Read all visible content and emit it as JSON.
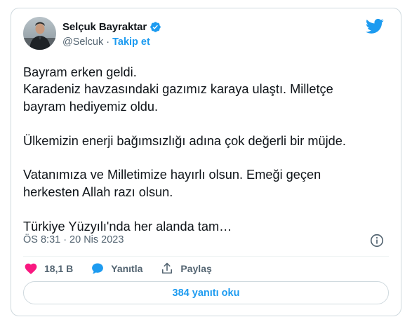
{
  "author": {
    "display_name": "Selçuk Bayraktar",
    "handle": "@Selcuk",
    "separator": "·",
    "follow_label": "Takip et",
    "verified": true
  },
  "tweet": {
    "lines": [
      "Bayram erken geldi.",
      "Karadeniz havzasındaki gazımız karaya ulaştı. Milletçe",
      "bayram hediyemiz oldu.",
      "",
      "Ülkemizin enerji bağımsızlığı adına çok değerli bir müjde.",
      "",
      "Vatanımıza ve Milletimize hayırlı olsun. Emeği geçen",
      "herkesten Allah razı olsun.",
      "",
      "Türkiye Yüzyılı'nda her alanda tam…"
    ]
  },
  "meta": {
    "time": "ÖS 8:31",
    "separator": "·",
    "date": "20 Nis 2023"
  },
  "actions": {
    "likes": "18,1 B",
    "reply_label": "Yanıtla",
    "share_label": "Paylaş"
  },
  "read_replies_label": "384 yanıtı oku",
  "colors": {
    "accent": "#1d9bf0",
    "like": "#f91880",
    "secondary_text": "#536471",
    "border": "#cfd9de"
  },
  "icons": [
    "verified-badge-icon",
    "twitter-bird-icon",
    "info-icon",
    "heart-icon",
    "reply-bubble-icon",
    "share-icon"
  ]
}
